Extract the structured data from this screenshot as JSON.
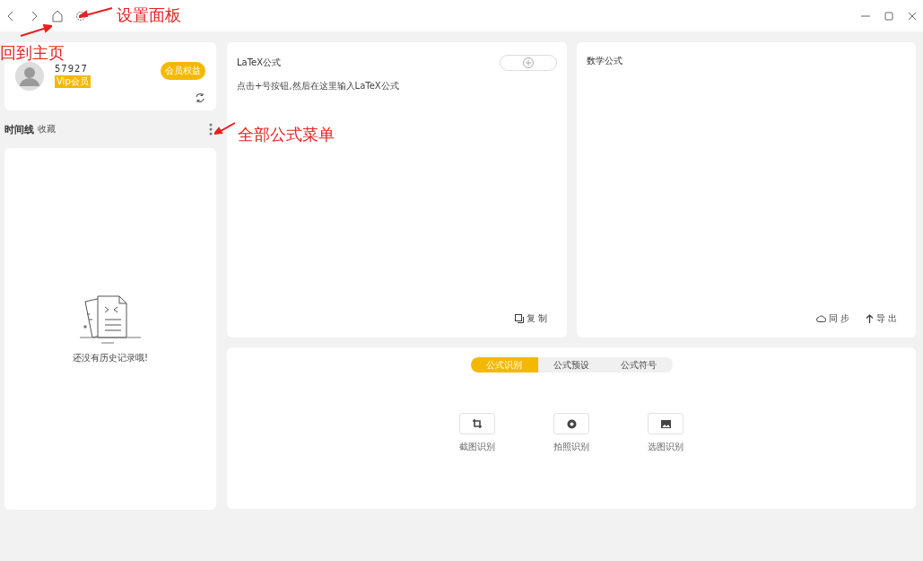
{
  "annotations": [
    {
      "text": "设置面板",
      "kind": "settings"
    },
    {
      "text": "回到主页",
      "kind": "home"
    },
    {
      "text": "全部公式菜单",
      "kind": "menu"
    }
  ],
  "profile": {
    "user_id": "57927",
    "vip_badge": "Vip会员",
    "benefits_button": "会员权益"
  },
  "timeline": {
    "title": "时间线",
    "favorites": "收藏",
    "empty_text": "还没有历史记录哦!"
  },
  "latex_panel": {
    "title": "LaTeX公式",
    "hint": "点击+号按钮,然后在这里输入LaTeX公式",
    "copy": "复 制"
  },
  "math_panel": {
    "title": "数学公式",
    "sync": "同 步",
    "export": "导 出"
  },
  "tabs": [
    {
      "label": "公式识别",
      "selected": true
    },
    {
      "label": "公式预设",
      "selected": false
    },
    {
      "label": "公式符号",
      "selected": false
    }
  ],
  "tools": [
    {
      "kind": "crop",
      "label": "截图识别"
    },
    {
      "kind": "camera",
      "label": "拍照识别"
    },
    {
      "kind": "image",
      "label": "选图识别"
    }
  ]
}
